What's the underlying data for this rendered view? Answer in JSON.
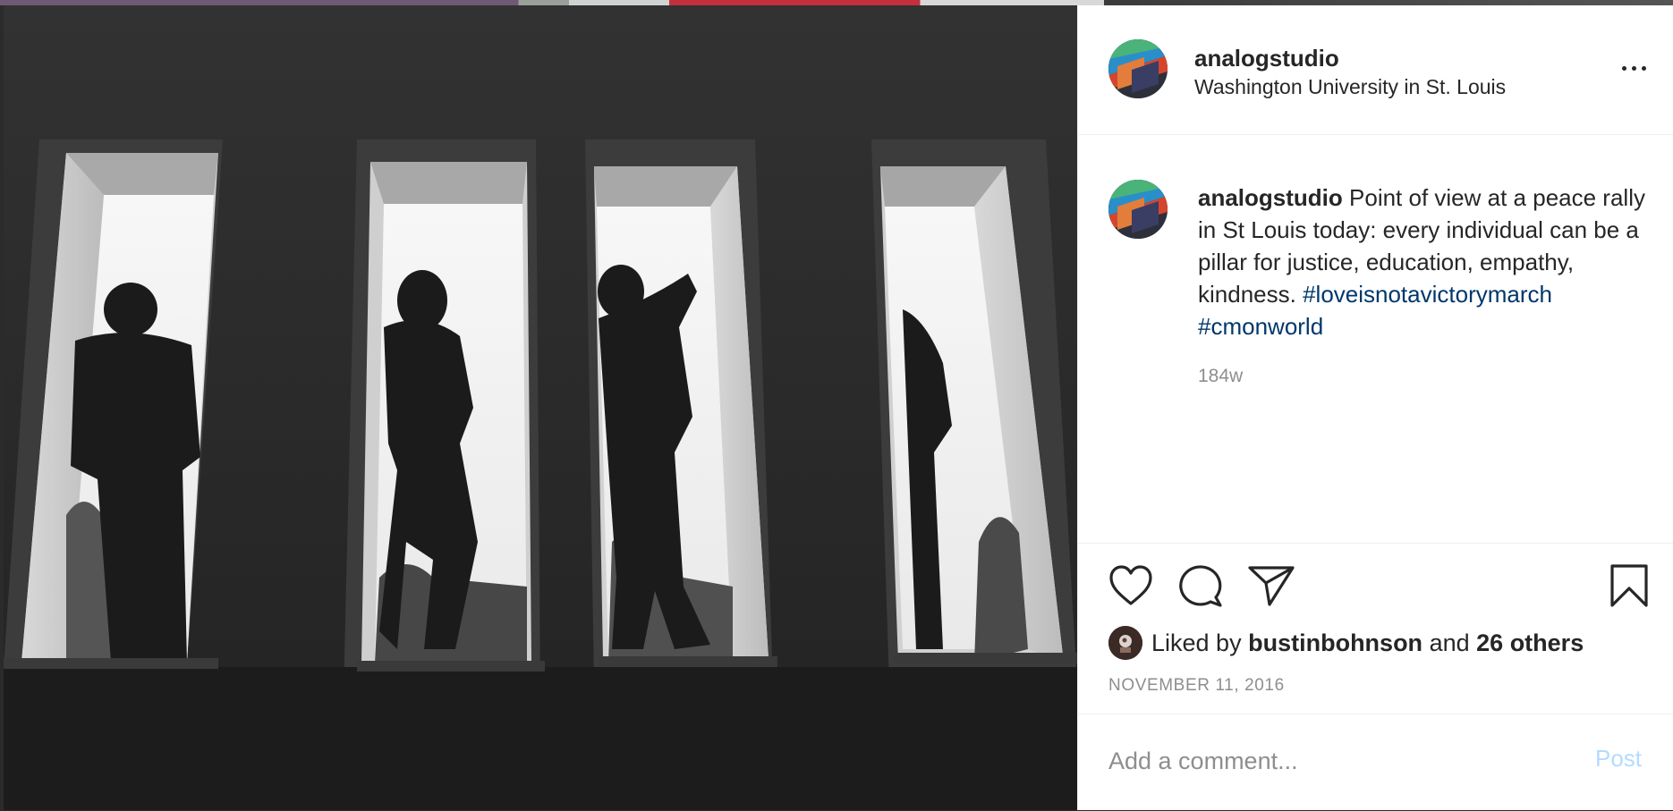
{
  "post": {
    "image_alt": "Black and white photo of people standing in tall windows",
    "author": {
      "username": "analogstudio",
      "location": "Washington University in St. Louis"
    },
    "caption": {
      "username": "analogstudio",
      "text": "Point of view at a peace rally in St Louis today: every individual can be a pillar for justice, education, empathy, kindness.",
      "hashtags": [
        "#loveisnotavictorymarch",
        "#cmonworld"
      ]
    },
    "time_ago": "184w",
    "likes": {
      "prefix": "Liked by",
      "user": "bustinbohnson",
      "connector": "and",
      "others": "26 others"
    },
    "date": "NOVEMBER 11, 2016",
    "comment": {
      "placeholder": "Add a comment...",
      "post_label": "Post"
    }
  },
  "icons": {
    "more": "more-options-icon",
    "like": "heart-icon",
    "comment": "comment-bubble-icon",
    "share": "paper-plane-icon",
    "save": "bookmark-icon"
  },
  "colors": {
    "text": "#262626",
    "secondary": "#8e8e8e",
    "hashtag": "#00376b",
    "post_disabled": "#b3dbff"
  }
}
